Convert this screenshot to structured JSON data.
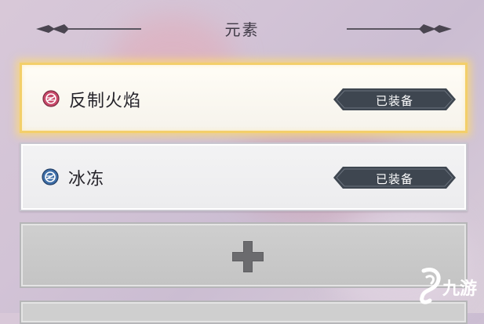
{
  "header": {
    "title": "元素"
  },
  "elements": [
    {
      "name": "反制火焰",
      "status": "已装备",
      "icon": "counter-fire-element-icon",
      "icon_color": "#c94a6a",
      "selected": true
    },
    {
      "name": "冰冻",
      "status": "已装备",
      "icon": "freeze-element-icon",
      "icon_color": "#3f6fa8",
      "selected": false
    }
  ],
  "add_slot": {
    "icon": "plus-icon"
  },
  "colors": {
    "selected_border": "#f3cf6a",
    "badge_fill": "#3e4650",
    "title_text": "#3f3a46"
  },
  "watermark": {
    "text": "九游"
  }
}
